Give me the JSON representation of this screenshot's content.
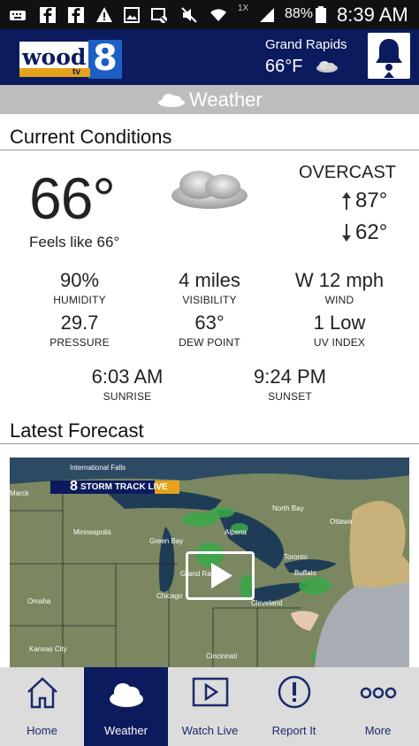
{
  "status_bar": {
    "oneX": "1X",
    "battery": "88%",
    "time": "8:39 AM",
    "icons": [
      "keyboard-icon",
      "facebook-icon",
      "facebook-icon",
      "warning-icon",
      "image-icon",
      "no-image-icon",
      "mute-icon",
      "wifi-icon",
      "signal-icon",
      "battery-icon"
    ]
  },
  "header": {
    "logo_text": "wood",
    "logo_number": "8",
    "logo_sub": "tv",
    "city": "Grand Rapids",
    "temp": "66°F",
    "icons": [
      "cloud-icon",
      "bell-icon"
    ]
  },
  "section_bar": {
    "title": "Weather",
    "icon": "cloud-icon"
  },
  "current": {
    "title": "Current Conditions",
    "temperature": "66°",
    "feels_like": "Feels like 66°",
    "condition": "OVERCAST",
    "high": "87°",
    "low": "62°",
    "stats": [
      {
        "value": "90%",
        "label": "HUMIDITY"
      },
      {
        "value": "4 miles",
        "label": "VISIBILITY"
      },
      {
        "value": "W 12 mph",
        "label": "WIND"
      },
      {
        "value": "29.7",
        "label": "PRESSURE"
      },
      {
        "value": "63°",
        "label": "DEW POINT"
      },
      {
        "value": "1 Low",
        "label": "UV INDEX"
      }
    ],
    "sun": [
      {
        "value": "6:03 AM",
        "label": "SUNRISE"
      },
      {
        "value": "9:24 PM",
        "label": "SUNSET"
      }
    ]
  },
  "forecast": {
    "title": "Latest Forecast",
    "banner": "STORM TRACK LIVE",
    "banner_num": "8",
    "cities": [
      "International Falls",
      "North Bay",
      "Ottawa",
      "Minneapolis",
      "Green Bay",
      "Alpena",
      "Toronto",
      "Buffalo",
      "Grand Rapids",
      "Chicago",
      "Cleveland",
      "Omaha",
      "Kansas City",
      "Cincinnati",
      "Marck"
    ]
  },
  "bottom_nav": {
    "items": [
      {
        "label": "Home",
        "icon": "home-icon",
        "active": false
      },
      {
        "label": "Weather",
        "icon": "cloud-icon",
        "active": true
      },
      {
        "label": "Watch Live",
        "icon": "play-icon",
        "active": false
      },
      {
        "label": "Report It",
        "icon": "exclamation-icon",
        "active": false
      },
      {
        "label": "More",
        "icon": "more-icon",
        "active": false
      }
    ]
  },
  "colors": {
    "brand_navy": "#0c1a5e",
    "section_gray": "#bdbdbd",
    "nav_gray": "#dcdcdc"
  }
}
